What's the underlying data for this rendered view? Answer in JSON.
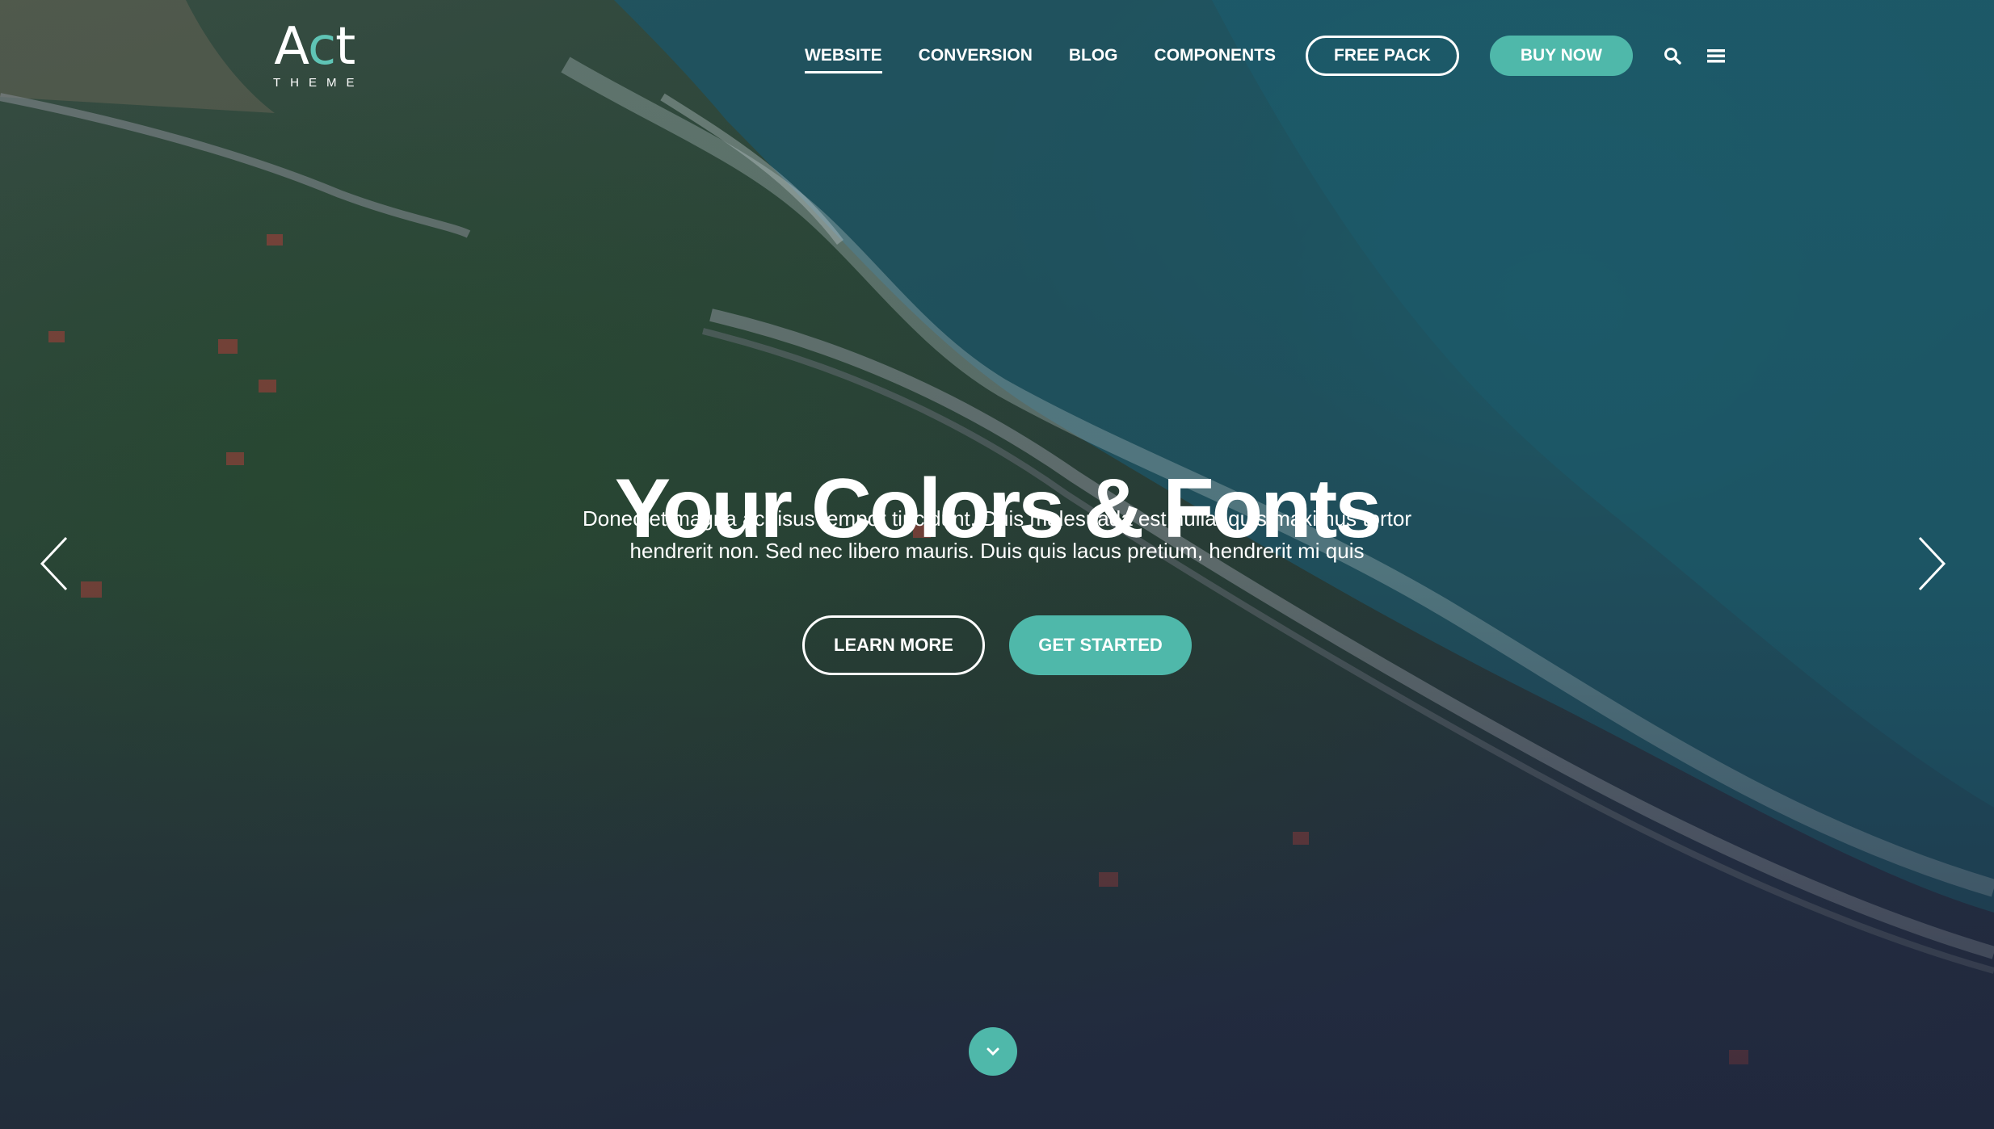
{
  "brand": {
    "name": "Act",
    "subtitle": "THEME",
    "accent": "#5fc4b5"
  },
  "nav": {
    "links": [
      {
        "label": "WEBSITE",
        "active": true
      },
      {
        "label": "CONVERSION",
        "active": false
      },
      {
        "label": "BLOG",
        "active": false
      },
      {
        "label": "COMPONENTS",
        "active": false
      }
    ],
    "free_pack_label": "FREE PACK",
    "buy_now_label": "BUY NOW",
    "icons": [
      "search-icon",
      "hamburger-menu-icon"
    ]
  },
  "hero": {
    "title": "Your Colors & Fonts",
    "description_line1": "Donec et magna ac risus tempor tincidunt. Duis malesuada est nulla, quis maximus tortor",
    "description_line2": "hendrerit non. Sed nec libero mauris. Duis quis lacus pretium, hendrerit mi quis",
    "learn_more_label": "LEARN MORE",
    "get_started_label": "GET STARTED",
    "background": "aerial coastline photo with dark overlay"
  },
  "slider": {
    "prev_icon": "chevron-left-icon",
    "next_icon": "chevron-right-icon"
  },
  "scroll": {
    "icon": "chevron-down-icon"
  },
  "colors": {
    "teal": "#4fb8aa",
    "overlay": "#2b3448",
    "text": "#ffffff"
  }
}
